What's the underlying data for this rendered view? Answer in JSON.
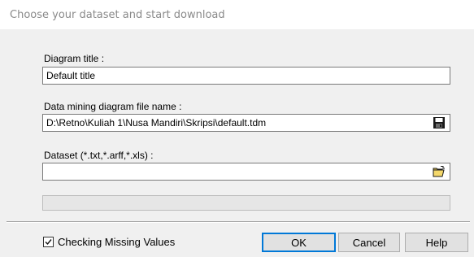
{
  "header": {
    "text": "Choose your dataset and start download"
  },
  "diagram_title": {
    "label": "Diagram title :",
    "value": "Default title"
  },
  "file_name": {
    "label": "Data mining diagram file name :",
    "value": "D:\\Retno\\Kuliah 1\\Nusa Mandiri\\Skripsi\\default.tdm",
    "icon": "save-icon"
  },
  "dataset": {
    "label": "Dataset (*.txt,*.arff,*.xls) :",
    "value": "",
    "icon": "open-folder-icon"
  },
  "progress": {
    "value": 0
  },
  "checkbox": {
    "label": "Checking Missing Values",
    "checked": true
  },
  "buttons": {
    "ok": "OK",
    "cancel": "Cancel",
    "help": "Help"
  }
}
